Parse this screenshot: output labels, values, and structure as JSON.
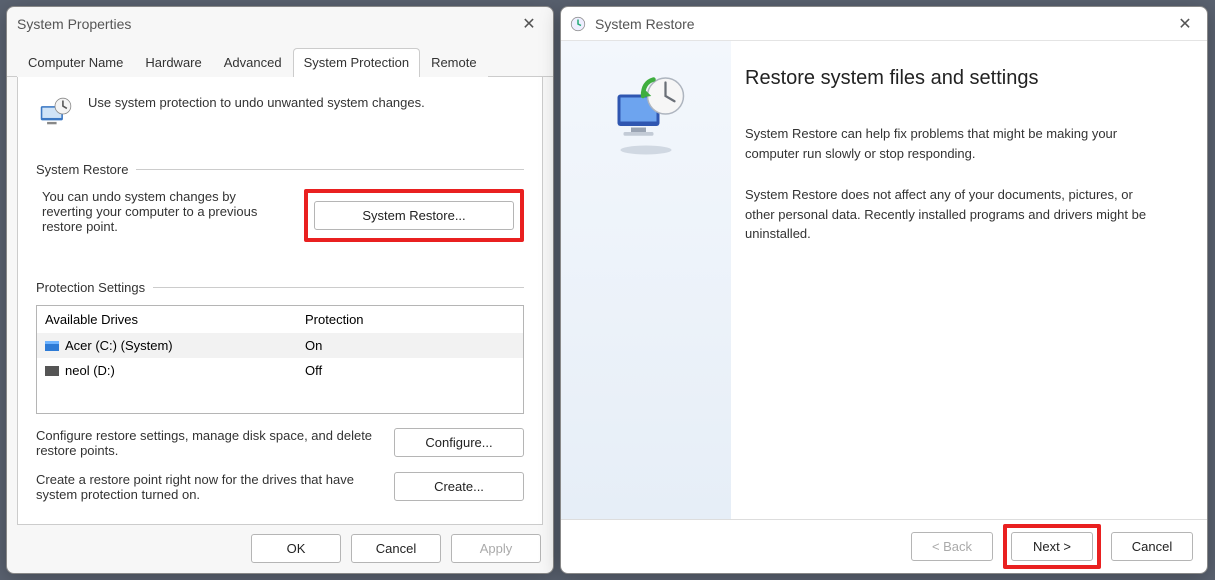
{
  "props_window": {
    "title": "System Properties",
    "tabs": [
      "Computer Name",
      "Hardware",
      "Advanced",
      "System Protection",
      "Remote"
    ],
    "active_tab": 3,
    "intro": "Use system protection to undo unwanted system changes.",
    "restore_section_title": "System Restore",
    "restore_desc": "You can undo system changes by reverting your computer to a previous restore point.",
    "restore_btn": "System Restore...",
    "prot_section_title": "Protection Settings",
    "drives_hdr": {
      "c1": "Available Drives",
      "c2": "Protection"
    },
    "drives": [
      {
        "name": "Acer (C:) (System)",
        "protection": "On",
        "sys": true
      },
      {
        "name": "neol (D:)",
        "protection": "Off",
        "sys": false
      }
    ],
    "configure_desc": "Configure restore settings, manage disk space, and delete restore points.",
    "configure_btn": "Configure...",
    "create_desc": "Create a restore point right now for the drives that have system protection turned on.",
    "create_btn": "Create...",
    "footer": {
      "ok": "OK",
      "cancel": "Cancel",
      "apply": "Apply"
    }
  },
  "restore_window": {
    "title": "System Restore",
    "heading": "Restore system files and settings",
    "p1": "System Restore can help fix problems that might be making your computer run slowly or stop responding.",
    "p2": "System Restore does not affect any of your documents, pictures, or other personal data. Recently installed programs and drivers might be uninstalled.",
    "footer": {
      "back": "< Back",
      "next": "Next >",
      "cancel": "Cancel"
    }
  }
}
